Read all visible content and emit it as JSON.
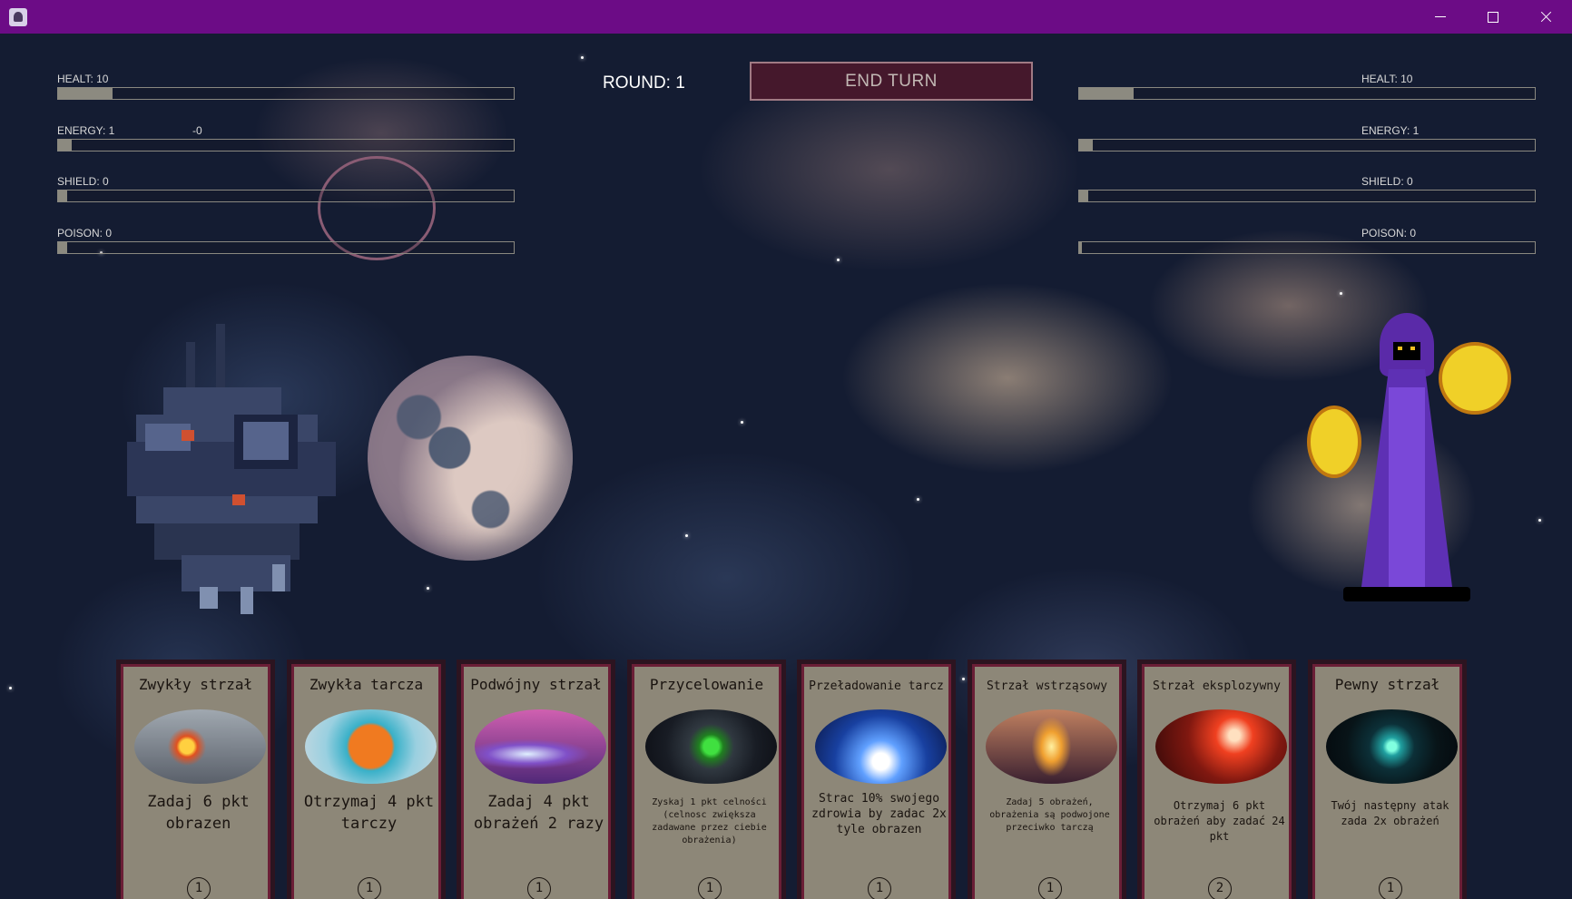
{
  "window": {
    "minimize_icon": "minimize-icon",
    "maximize_icon": "maximize-icon",
    "close_icon": "close-icon"
  },
  "hud": {
    "round_label": "ROUND: 1",
    "end_turn_label": "END TURN"
  },
  "player": {
    "health_label": "HEALT: 10",
    "health_fraction": 0.12,
    "energy_label": "ENERGY: 1",
    "energy_delta": "-0",
    "energy_fraction": 0.03,
    "shield_label": "SHIELD: 0",
    "shield_fraction": 0.02,
    "poison_label": "POISON: 0",
    "poison_fraction": 0.02
  },
  "enemy": {
    "health_label": "HEALT: 10",
    "health_fraction": 0.12,
    "energy_label": "ENERGY: 1",
    "energy_fraction": 0.03,
    "shield_label": "SHIELD: 0",
    "shield_fraction": 0.02,
    "poison_label": "POISON: 0",
    "poison_fraction": 0.005
  },
  "cards": [
    {
      "title": "Zwykły strzał",
      "desc": "Zadaj 6 pkt obrazen",
      "cost": "1"
    },
    {
      "title": "Zwykła tarcza",
      "desc": "Otrzymaj 4 pkt tarczy",
      "cost": "1"
    },
    {
      "title": "Podwójny strzał",
      "desc": "Zadaj 4 pkt obrażeń 2 razy",
      "cost": "1"
    },
    {
      "title": "Przycelowanie",
      "desc": "Zyskaj 1 pkt celności (celnosc zwiększa zadawane przez ciebie obrażenia)",
      "cost": "1"
    },
    {
      "title": "Przeładowanie tarcz",
      "desc": "Strac 10% swojego zdrowia by zadac 2x tyle obrazen",
      "cost": "1"
    },
    {
      "title": "Strzał wstrząsowy",
      "desc": "Zadaj 5 obrażeń, obrażenia są podwojone przeciwko tarczą",
      "cost": "1"
    },
    {
      "title": "Strzał eksplozywny",
      "desc": "Otrzymaj 6 pkt obrażeń aby zadać 24 pkt",
      "cost": "2"
    },
    {
      "title": "Pewny strzał",
      "desc": "Twój następny atak zada 2x obrażeń",
      "cost": "1"
    }
  ],
  "colors": {
    "titlebar": "#6c0c86",
    "end_turn_bg": "#45182c",
    "card_bg": "#8d8778",
    "card_border": "#6a1e36"
  }
}
